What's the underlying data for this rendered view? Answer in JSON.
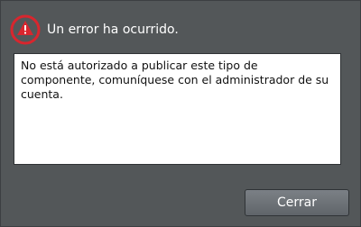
{
  "dialog": {
    "title": "Un error ha ocurrido.",
    "icon": "warning-icon",
    "message": "No está autorizado a publicar este tipo de componente, comuníquese con el administrador de su cuenta.",
    "close_label": "Cerrar"
  },
  "colors": {
    "icon_red": "#d8262e",
    "background": "#535759"
  }
}
